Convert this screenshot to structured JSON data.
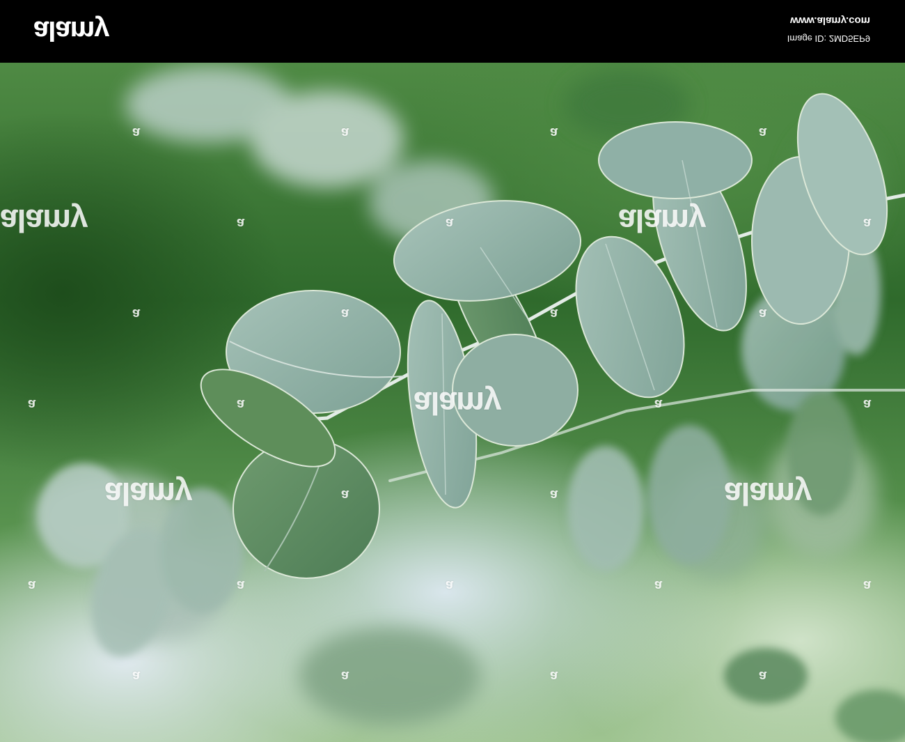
{
  "header": {
    "logo_text": "alamy",
    "site_url": "www.alamy.com",
    "image_id_text": "Image ID: 2MD5EP9"
  },
  "photo": {
    "subject": "eucalyptus branch with round silver-green leaves",
    "watermark_text": "alamy",
    "watermark_mark": "a",
    "colors": {
      "leaf_silver": "#8fb0a6",
      "leaf_green": "#5d8b62",
      "stem": "#e3ece6",
      "bg_dark": "#2f6a2c",
      "bg_light": "#dfe9ee"
    }
  }
}
